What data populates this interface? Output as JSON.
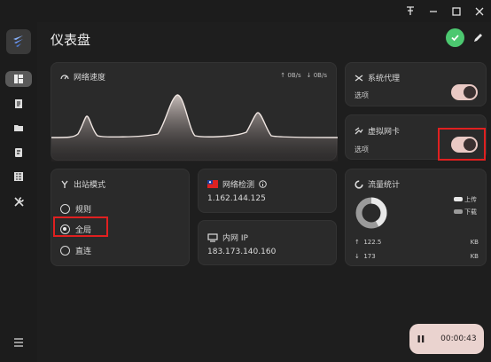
{
  "window": {
    "pin_icon": "pin-icon",
    "minimize_icon": "minimize-icon",
    "maximize_icon": "maximize-icon",
    "close_icon": "close-icon"
  },
  "page": {
    "title": "仪表盘"
  },
  "sidebar": {
    "items": [
      {
        "name": "dashboard",
        "icon": "dashboard-icon",
        "active": true
      },
      {
        "name": "proxies",
        "icon": "document-icon",
        "active": false
      },
      {
        "name": "profiles",
        "icon": "folder-icon",
        "active": false
      },
      {
        "name": "connections",
        "icon": "list-icon",
        "active": false
      },
      {
        "name": "rules",
        "icon": "rules-icon",
        "active": false
      },
      {
        "name": "settings",
        "icon": "tools-icon",
        "active": false
      }
    ]
  },
  "speed": {
    "title": "网络速度",
    "upload": "↑ 0B/s",
    "download": "↓ 0B/s"
  },
  "system_proxy": {
    "title": "系统代理",
    "option_label": "选项",
    "enabled": true
  },
  "tun": {
    "title": "虚拟网卡",
    "option_label": "选项",
    "enabled": true
  },
  "outbound": {
    "title": "出站模式",
    "options": [
      {
        "label": "规则",
        "checked": false
      },
      {
        "label": "全局",
        "checked": true
      },
      {
        "label": "直连",
        "checked": false
      }
    ]
  },
  "net_check": {
    "title": "网络检测",
    "ip": "1.162.144.125"
  },
  "intranet": {
    "title": "内网 IP",
    "ip": "183.173.140.160"
  },
  "traffic": {
    "title": "流量统计",
    "legend_upload": "上传",
    "legend_download": "下载",
    "upload_value": "122.5",
    "upload_unit": "KB",
    "download_value": "173",
    "download_unit": "KB",
    "upload_arrow": "↑",
    "download_arrow": "↓",
    "colors": {
      "upload": "#e8e8e8",
      "download": "#9a9a9a"
    }
  },
  "timer": {
    "time": "00:00:43"
  }
}
